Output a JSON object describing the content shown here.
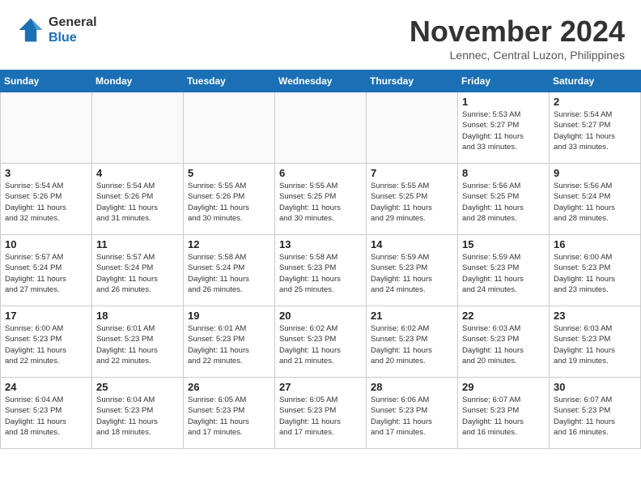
{
  "header": {
    "logo_general": "General",
    "logo_blue": "Blue",
    "month_title": "November 2024",
    "location": "Lennec, Central Luzon, Philippines"
  },
  "weekdays": [
    "Sunday",
    "Monday",
    "Tuesday",
    "Wednesday",
    "Thursday",
    "Friday",
    "Saturday"
  ],
  "weeks": [
    [
      {
        "day": "",
        "info": ""
      },
      {
        "day": "",
        "info": ""
      },
      {
        "day": "",
        "info": ""
      },
      {
        "day": "",
        "info": ""
      },
      {
        "day": "",
        "info": ""
      },
      {
        "day": "1",
        "info": "Sunrise: 5:53 AM\nSunset: 5:27 PM\nDaylight: 11 hours\nand 33 minutes."
      },
      {
        "day": "2",
        "info": "Sunrise: 5:54 AM\nSunset: 5:27 PM\nDaylight: 11 hours\nand 33 minutes."
      }
    ],
    [
      {
        "day": "3",
        "info": "Sunrise: 5:54 AM\nSunset: 5:26 PM\nDaylight: 11 hours\nand 32 minutes."
      },
      {
        "day": "4",
        "info": "Sunrise: 5:54 AM\nSunset: 5:26 PM\nDaylight: 11 hours\nand 31 minutes."
      },
      {
        "day": "5",
        "info": "Sunrise: 5:55 AM\nSunset: 5:26 PM\nDaylight: 11 hours\nand 30 minutes."
      },
      {
        "day": "6",
        "info": "Sunrise: 5:55 AM\nSunset: 5:25 PM\nDaylight: 11 hours\nand 30 minutes."
      },
      {
        "day": "7",
        "info": "Sunrise: 5:55 AM\nSunset: 5:25 PM\nDaylight: 11 hours\nand 29 minutes."
      },
      {
        "day": "8",
        "info": "Sunrise: 5:56 AM\nSunset: 5:25 PM\nDaylight: 11 hours\nand 28 minutes."
      },
      {
        "day": "9",
        "info": "Sunrise: 5:56 AM\nSunset: 5:24 PM\nDaylight: 11 hours\nand 28 minutes."
      }
    ],
    [
      {
        "day": "10",
        "info": "Sunrise: 5:57 AM\nSunset: 5:24 PM\nDaylight: 11 hours\nand 27 minutes."
      },
      {
        "day": "11",
        "info": "Sunrise: 5:57 AM\nSunset: 5:24 PM\nDaylight: 11 hours\nand 26 minutes."
      },
      {
        "day": "12",
        "info": "Sunrise: 5:58 AM\nSunset: 5:24 PM\nDaylight: 11 hours\nand 26 minutes."
      },
      {
        "day": "13",
        "info": "Sunrise: 5:58 AM\nSunset: 5:23 PM\nDaylight: 11 hours\nand 25 minutes."
      },
      {
        "day": "14",
        "info": "Sunrise: 5:59 AM\nSunset: 5:23 PM\nDaylight: 11 hours\nand 24 minutes."
      },
      {
        "day": "15",
        "info": "Sunrise: 5:59 AM\nSunset: 5:23 PM\nDaylight: 11 hours\nand 24 minutes."
      },
      {
        "day": "16",
        "info": "Sunrise: 6:00 AM\nSunset: 5:23 PM\nDaylight: 11 hours\nand 23 minutes."
      }
    ],
    [
      {
        "day": "17",
        "info": "Sunrise: 6:00 AM\nSunset: 5:23 PM\nDaylight: 11 hours\nand 22 minutes."
      },
      {
        "day": "18",
        "info": "Sunrise: 6:01 AM\nSunset: 5:23 PM\nDaylight: 11 hours\nand 22 minutes."
      },
      {
        "day": "19",
        "info": "Sunrise: 6:01 AM\nSunset: 5:23 PM\nDaylight: 11 hours\nand 22 minutes."
      },
      {
        "day": "20",
        "info": "Sunrise: 6:02 AM\nSunset: 5:23 PM\nDaylight: 11 hours\nand 21 minutes."
      },
      {
        "day": "21",
        "info": "Sunrise: 6:02 AM\nSunset: 5:23 PM\nDaylight: 11 hours\nand 20 minutes."
      },
      {
        "day": "22",
        "info": "Sunrise: 6:03 AM\nSunset: 5:23 PM\nDaylight: 11 hours\nand 20 minutes."
      },
      {
        "day": "23",
        "info": "Sunrise: 6:03 AM\nSunset: 5:23 PM\nDaylight: 11 hours\nand 19 minutes."
      }
    ],
    [
      {
        "day": "24",
        "info": "Sunrise: 6:04 AM\nSunset: 5:23 PM\nDaylight: 11 hours\nand 18 minutes."
      },
      {
        "day": "25",
        "info": "Sunrise: 6:04 AM\nSunset: 5:23 PM\nDaylight: 11 hours\nand 18 minutes."
      },
      {
        "day": "26",
        "info": "Sunrise: 6:05 AM\nSunset: 5:23 PM\nDaylight: 11 hours\nand 17 minutes."
      },
      {
        "day": "27",
        "info": "Sunrise: 6:05 AM\nSunset: 5:23 PM\nDaylight: 11 hours\nand 17 minutes."
      },
      {
        "day": "28",
        "info": "Sunrise: 6:06 AM\nSunset: 5:23 PM\nDaylight: 11 hours\nand 17 minutes."
      },
      {
        "day": "29",
        "info": "Sunrise: 6:07 AM\nSunset: 5:23 PM\nDaylight: 11 hours\nand 16 minutes."
      },
      {
        "day": "30",
        "info": "Sunrise: 6:07 AM\nSunset: 5:23 PM\nDaylight: 11 hours\nand 16 minutes."
      }
    ]
  ]
}
